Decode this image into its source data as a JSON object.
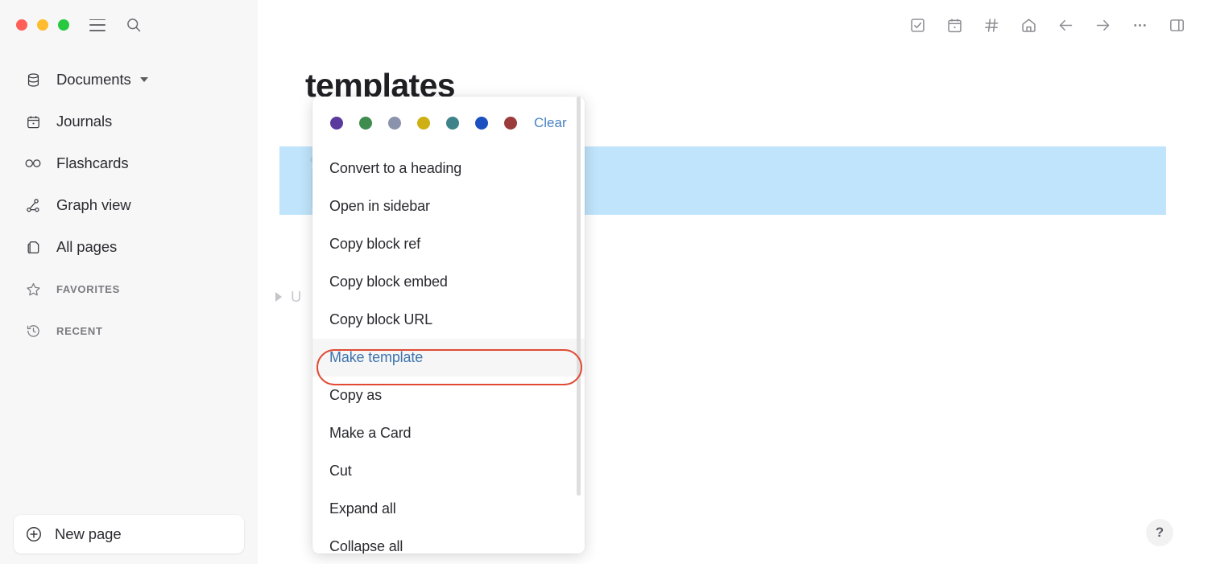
{
  "window": {
    "traffic_lights": [
      "close",
      "minimize",
      "maximize"
    ],
    "colors": {
      "close": "#ff5f57",
      "minimize": "#febc2e",
      "maximize": "#28c840",
      "sidebar_bg": "#f7f7f8",
      "main_bg": "#ffffff",
      "selection_highlight": "#bfe4fb",
      "annotation": "#e04b35",
      "accent_link": "#4a83c4"
    }
  },
  "sidebar": {
    "menu_icon": "hamburger-icon",
    "search_icon": "search-icon",
    "items": [
      {
        "label": "Documents",
        "icon": "database-icon",
        "has_chevron": true
      },
      {
        "label": "Journals",
        "icon": "calendar-icon",
        "has_chevron": false
      },
      {
        "label": "Flashcards",
        "icon": "infinity-icon",
        "has_chevron": false
      },
      {
        "label": "Graph view",
        "icon": "graph-icon",
        "has_chevron": false
      },
      {
        "label": "All pages",
        "icon": "pages-icon",
        "has_chevron": false
      }
    ],
    "sections": [
      {
        "label": "FAVORITES",
        "icon": "star-icon"
      },
      {
        "label": "RECENT",
        "icon": "history-icon"
      }
    ],
    "new_page": {
      "label": "New page",
      "icon": "plus-circle-icon"
    }
  },
  "toolbar": {
    "buttons": [
      {
        "name": "todo-icon",
        "title": "Todo"
      },
      {
        "name": "calendar-icon",
        "title": "Journal"
      },
      {
        "name": "hash-icon",
        "title": "Tags"
      },
      {
        "name": "home-icon",
        "title": "Home"
      },
      {
        "name": "arrow-left-icon",
        "title": "Back"
      },
      {
        "name": "arrow-right-icon",
        "title": "Forward"
      },
      {
        "name": "ellipsis-icon",
        "title": "More"
      },
      {
        "name": "right-sidebar-icon",
        "title": "Toggle right sidebar"
      }
    ]
  },
  "main": {
    "page_title": "templates",
    "collapsed_block_text": "U",
    "help_button": "?"
  },
  "context_menu": {
    "colors": [
      {
        "name": "purple",
        "hex": "#5b3a9e"
      },
      {
        "name": "green",
        "hex": "#3e8c4e"
      },
      {
        "name": "gray",
        "hex": "#8b92ab"
      },
      {
        "name": "yellow",
        "hex": "#cfb014"
      },
      {
        "name": "teal",
        "hex": "#3e8389"
      },
      {
        "name": "blue",
        "hex": "#1c4fbf"
      },
      {
        "name": "red",
        "hex": "#9c3b3b"
      }
    ],
    "clear_label": "Clear",
    "items": [
      {
        "label": "Convert to a heading",
        "highlighted": false
      },
      {
        "label": "Open in sidebar",
        "highlighted": false
      },
      {
        "label": "Copy block ref",
        "highlighted": false
      },
      {
        "label": "Copy block embed",
        "highlighted": false
      },
      {
        "label": "Copy block URL",
        "highlighted": false
      },
      {
        "label": "Make template",
        "highlighted": true
      },
      {
        "label": "Copy as",
        "highlighted": false
      },
      {
        "label": "Make a Card",
        "highlighted": false
      },
      {
        "label": "Cut",
        "highlighted": false
      },
      {
        "label": "Expand all",
        "highlighted": false
      },
      {
        "label": "Collapse all",
        "highlighted": false
      }
    ]
  }
}
